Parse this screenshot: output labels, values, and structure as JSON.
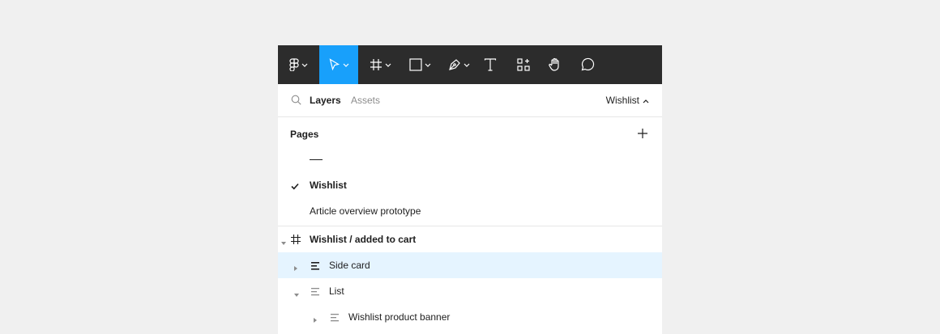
{
  "toolbar": {
    "tools": [
      {
        "name": "main-menu",
        "icon": "figma-logo-icon",
        "has_dropdown": true
      },
      {
        "name": "move-tool",
        "icon": "cursor-arrow-icon",
        "has_dropdown": true,
        "active": true
      },
      {
        "name": "frame-tool",
        "icon": "frame-hash-icon",
        "has_dropdown": true
      },
      {
        "name": "shape-tool",
        "icon": "rectangle-icon",
        "has_dropdown": true
      },
      {
        "name": "pen-tool",
        "icon": "pen-icon",
        "has_dropdown": true
      },
      {
        "name": "text-tool",
        "icon": "text-icon",
        "has_dropdown": false
      },
      {
        "name": "resources-tool",
        "icon": "components-icon",
        "has_dropdown": false
      },
      {
        "name": "hand-tool",
        "icon": "hand-icon",
        "has_dropdown": false
      },
      {
        "name": "comment-tool",
        "icon": "comment-icon",
        "has_dropdown": false
      }
    ],
    "active_color": "#18a0fb",
    "bg_color": "#2c2c2c"
  },
  "tabs": {
    "layers_label": "Layers",
    "assets_label": "Assets",
    "current_page": "Wishlist"
  },
  "pages": {
    "title": "Pages",
    "items": [
      {
        "label": "——",
        "separator": true
      },
      {
        "label": "Wishlist",
        "selected": true
      },
      {
        "label": "Article overview prototype"
      }
    ]
  },
  "layers": {
    "items": [
      {
        "name": "Wishlist / added to cart",
        "type": "frame",
        "expanded": true
      },
      {
        "name": "Side card",
        "type": "auto-layout",
        "expanded": false,
        "highlighted": true
      },
      {
        "name": "List",
        "type": "auto-layout",
        "expanded": true
      },
      {
        "name": "Wishlist product banner",
        "type": "auto-layout",
        "expanded": false
      }
    ],
    "highlight_color": "#e5f4ff"
  }
}
